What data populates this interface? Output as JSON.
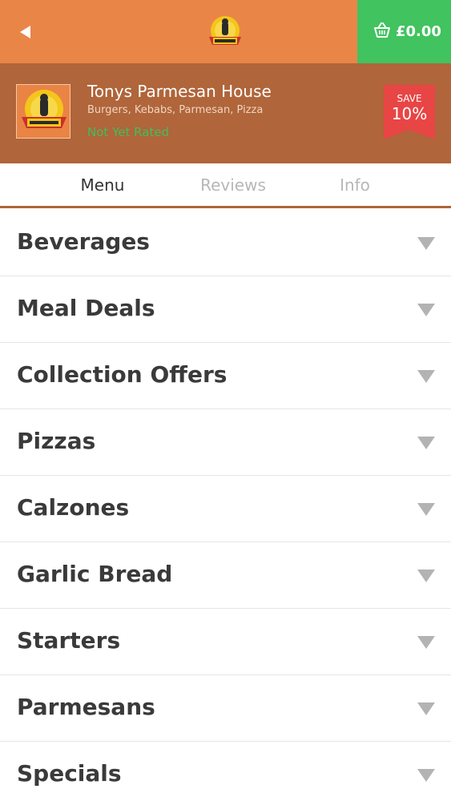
{
  "header": {
    "back_icon": "back-arrow-icon",
    "logo_alt": "Tonys Parmesan House logo",
    "cart_icon": "basket-icon",
    "cart_total": "£0.00"
  },
  "restaurant": {
    "name": "Tonys Parmesan House",
    "cuisines": "Burgers, Kebabs, Parmesan, Pizza",
    "rating": "Not Yet Rated",
    "badge": {
      "label": "SAVE",
      "value": "10%"
    }
  },
  "tabs": [
    {
      "label": "Menu",
      "active": true
    },
    {
      "label": "Reviews",
      "active": false
    },
    {
      "label": "Info",
      "active": false
    }
  ],
  "categories": [
    "Beverages",
    "Meal Deals",
    "Collection Offers",
    "Pizzas",
    "Calzones",
    "Garlic Bread",
    "Starters",
    "Parmesans",
    "Specials"
  ],
  "colors": {
    "topbar": "#ea8548",
    "cart": "#41c35f",
    "band": "#b0653a",
    "rating": "#3fbf5d",
    "save_badge": "#e84545"
  }
}
